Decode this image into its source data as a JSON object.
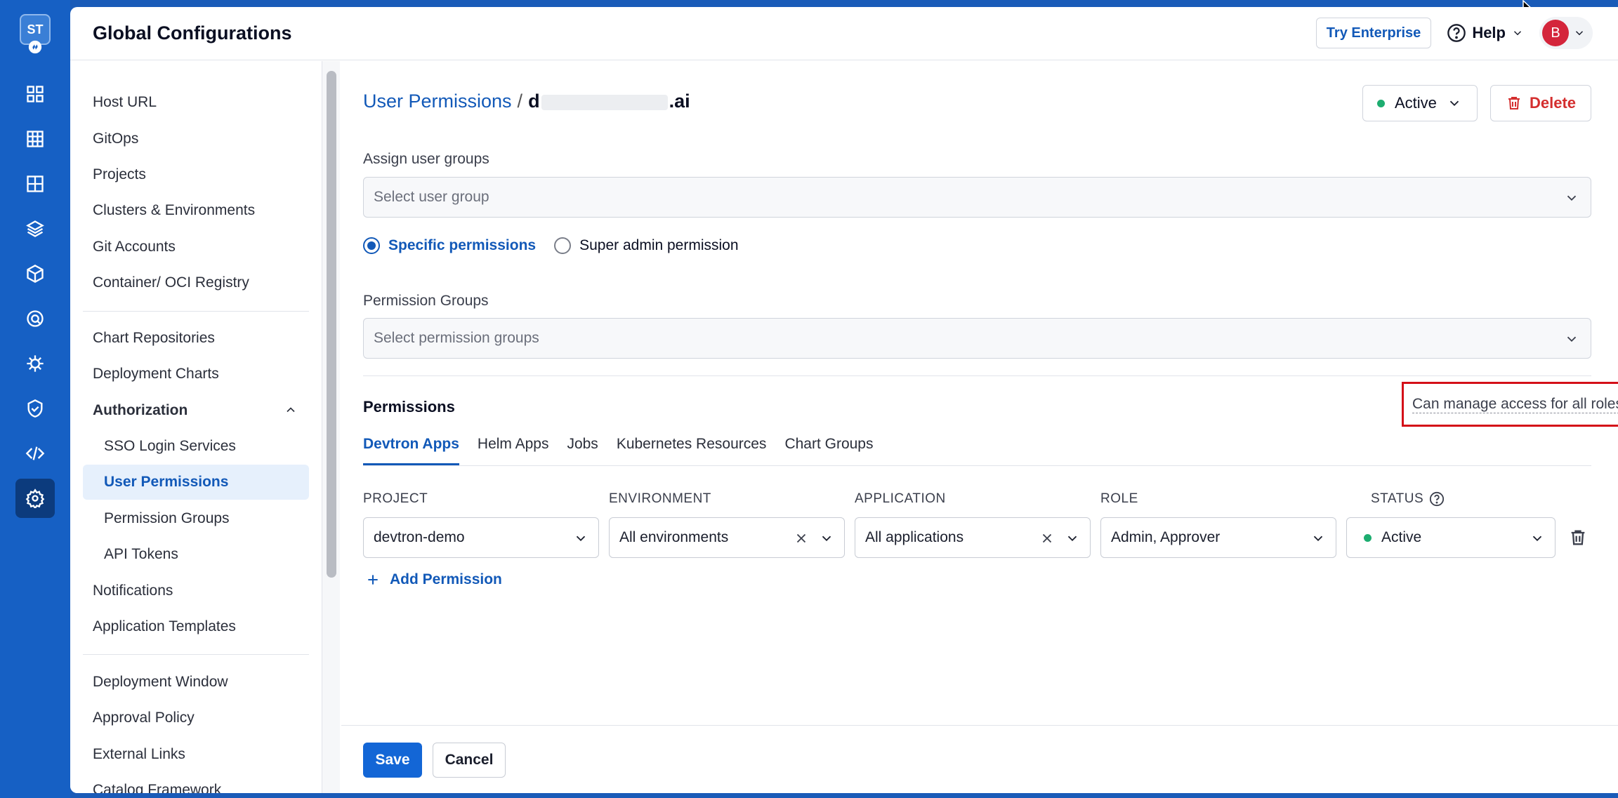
{
  "rail": {
    "logo_text": "ST",
    "icons": [
      "overview-icon",
      "applications-icon",
      "app-grid-icon",
      "layers-icon",
      "cube-icon",
      "security-scan-icon",
      "bug-icon",
      "shield-icon",
      "code-icon",
      "settings-icon"
    ]
  },
  "topbar": {
    "title": "Global Configurations",
    "try_enterprise": "Try Enterprise",
    "help": "Help",
    "avatar_initial": "B"
  },
  "sidebar": {
    "items": [
      {
        "label": "Host URL"
      },
      {
        "label": "GitOps"
      },
      {
        "label": "Projects"
      },
      {
        "label": "Clusters & Environments"
      },
      {
        "label": "Git Accounts"
      },
      {
        "label": "Container/ OCI Registry"
      },
      {
        "label": "Chart Repositories"
      },
      {
        "label": "Deployment Charts"
      },
      {
        "label": "Authorization"
      },
      {
        "label": "SSO Login Services"
      },
      {
        "label": "User Permissions"
      },
      {
        "label": "Permission Groups"
      },
      {
        "label": "API Tokens"
      },
      {
        "label": "Notifications"
      },
      {
        "label": "Application Templates"
      },
      {
        "label": "Deployment Window"
      },
      {
        "label": "Approval Policy"
      },
      {
        "label": "External Links"
      },
      {
        "label": "Catalog Framework"
      }
    ]
  },
  "header": {
    "breadcrumb_link": "User Permissions",
    "breadcrumb_sep": "/",
    "user_prefix": "d",
    "user_suffix": ".ai",
    "status": "Active",
    "delete": "Delete"
  },
  "form": {
    "assign_label": "Assign user groups",
    "assign_placeholder": "Select user group",
    "radio_specific": "Specific permissions",
    "radio_super": "Super admin permission",
    "perm_groups_label": "Permission Groups",
    "perm_groups_placeholder": "Select permission groups",
    "permissions_title": "Permissions",
    "manage_access": "Can manage access for all roles",
    "tabs": [
      "Devtron Apps",
      "Helm Apps",
      "Jobs",
      "Kubernetes Resources",
      "Chart Groups"
    ],
    "columns": [
      "PROJECT",
      "ENVIRONMENT",
      "APPLICATION",
      "ROLE",
      "STATUS"
    ],
    "row": {
      "project": "devtron-demo",
      "environment": "All environments",
      "application": "All applications",
      "role": "Admin, Approver",
      "status": "Active"
    },
    "add_permission": "Add Permission",
    "save": "Save",
    "cancel": "Cancel"
  },
  "colors": {
    "accent": "#1259b8",
    "rail": "#1660c4",
    "success": "#1dad70",
    "danger": "#d42e2e",
    "highlight": "#d40f18"
  }
}
